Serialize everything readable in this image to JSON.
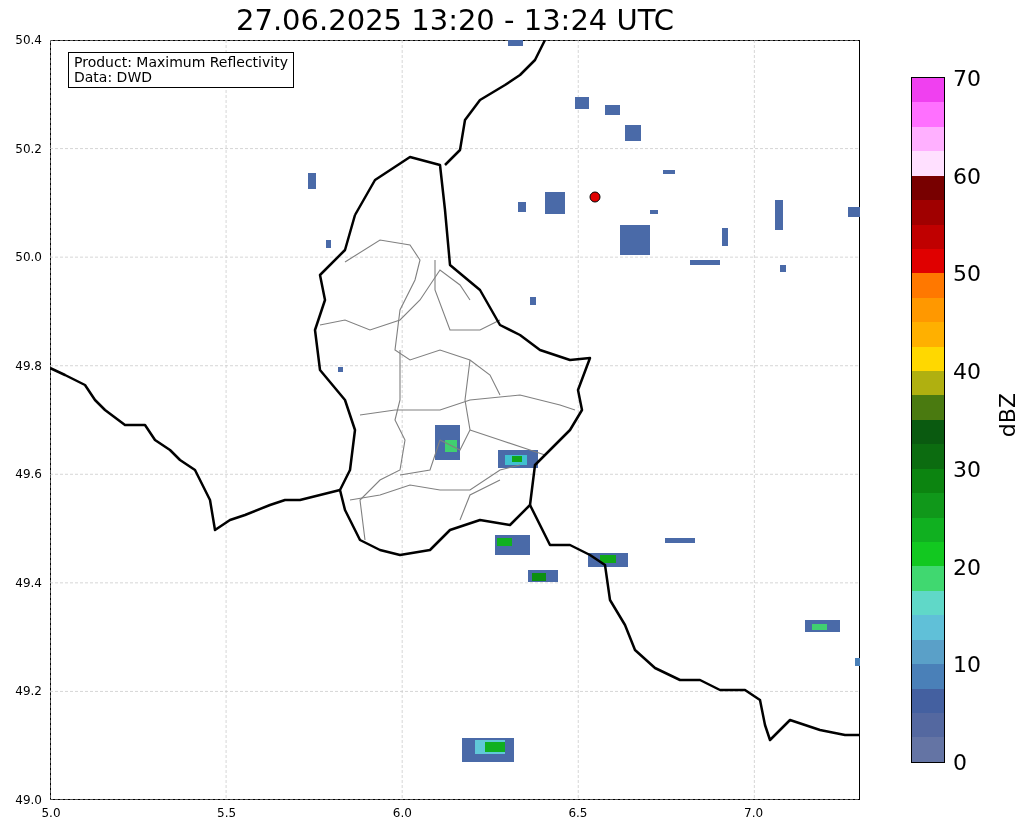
{
  "title": "27.06.2025 13:20 - 13:24 UTC",
  "info_box": [
    "Product: Maximum Reflectivity",
    "Data: DWD"
  ],
  "x_ticks": [
    "5.0",
    "5.5",
    "6.0",
    "6.5",
    "7.0"
  ],
  "y_ticks": [
    "50.4",
    "50.2",
    "50.0",
    "49.8",
    "49.6",
    "49.4",
    "49.2",
    "49.0"
  ],
  "colorbar": {
    "label": "dBZ",
    "ticks": [
      "70",
      "60",
      "50",
      "40",
      "30",
      "20",
      "10",
      "0"
    ],
    "bands": [
      {
        "color": "#6474a4"
      },
      {
        "color": "#5468a0"
      },
      {
        "color": "#4460a0"
      },
      {
        "color": "#4a80b8"
      },
      {
        "color": "#5aa0c8"
      },
      {
        "color": "#60c0d8"
      },
      {
        "color": "#60d8c8"
      },
      {
        "color": "#40d870"
      },
      {
        "color": "#12c820"
      },
      {
        "color": "#10b020"
      },
      {
        "color": "#10981a"
      },
      {
        "color": "#0c8410"
      },
      {
        "color": "#0c6c10"
      },
      {
        "color": "#0a5a10"
      },
      {
        "color": "#4a7a10"
      },
      {
        "color": "#b0b010"
      },
      {
        "color": "#ffd800"
      },
      {
        "color": "#ffb000"
      },
      {
        "color": "#ff9800"
      },
      {
        "color": "#ff7800"
      },
      {
        "color": "#e00000"
      },
      {
        "color": "#c00000"
      },
      {
        "color": "#a00000"
      },
      {
        "color": "#780000"
      },
      {
        "color": "#ffe0ff"
      },
      {
        "color": "#ffb0ff"
      },
      {
        "color": "#ff70ff"
      },
      {
        "color": "#f040f0"
      }
    ]
  }
}
